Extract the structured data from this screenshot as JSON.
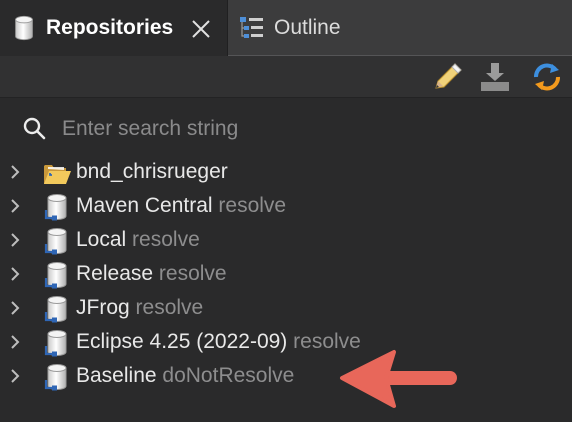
{
  "tabs": {
    "repositories": {
      "label": "Repositories",
      "icon": "database-icon"
    },
    "outline": {
      "label": "Outline",
      "icon": "outline-icon"
    }
  },
  "search": {
    "placeholder": "Enter search string",
    "value": ""
  },
  "tree": [
    {
      "name": "bnd_chrisrueger",
      "action": "",
      "icon": "folder-open-icon"
    },
    {
      "name": "Maven Central",
      "action": "resolve",
      "icon": "repository-icon"
    },
    {
      "name": "Local",
      "action": "resolve",
      "icon": "repository-icon"
    },
    {
      "name": "Release",
      "action": "resolve",
      "icon": "repository-icon"
    },
    {
      "name": "JFrog",
      "action": "resolve",
      "icon": "repository-icon"
    },
    {
      "name": "Eclipse 4.25 (2022-09)",
      "action": "resolve",
      "icon": "repository-icon"
    },
    {
      "name": "Baseline",
      "action": "doNotResolve",
      "icon": "repository-icon"
    }
  ],
  "colors": {
    "background": "#2a2a2b",
    "text": "#e8e8e8",
    "muted": "#8d8d8e",
    "arrow": "#e8675a",
    "folder": "#f2c95c"
  }
}
